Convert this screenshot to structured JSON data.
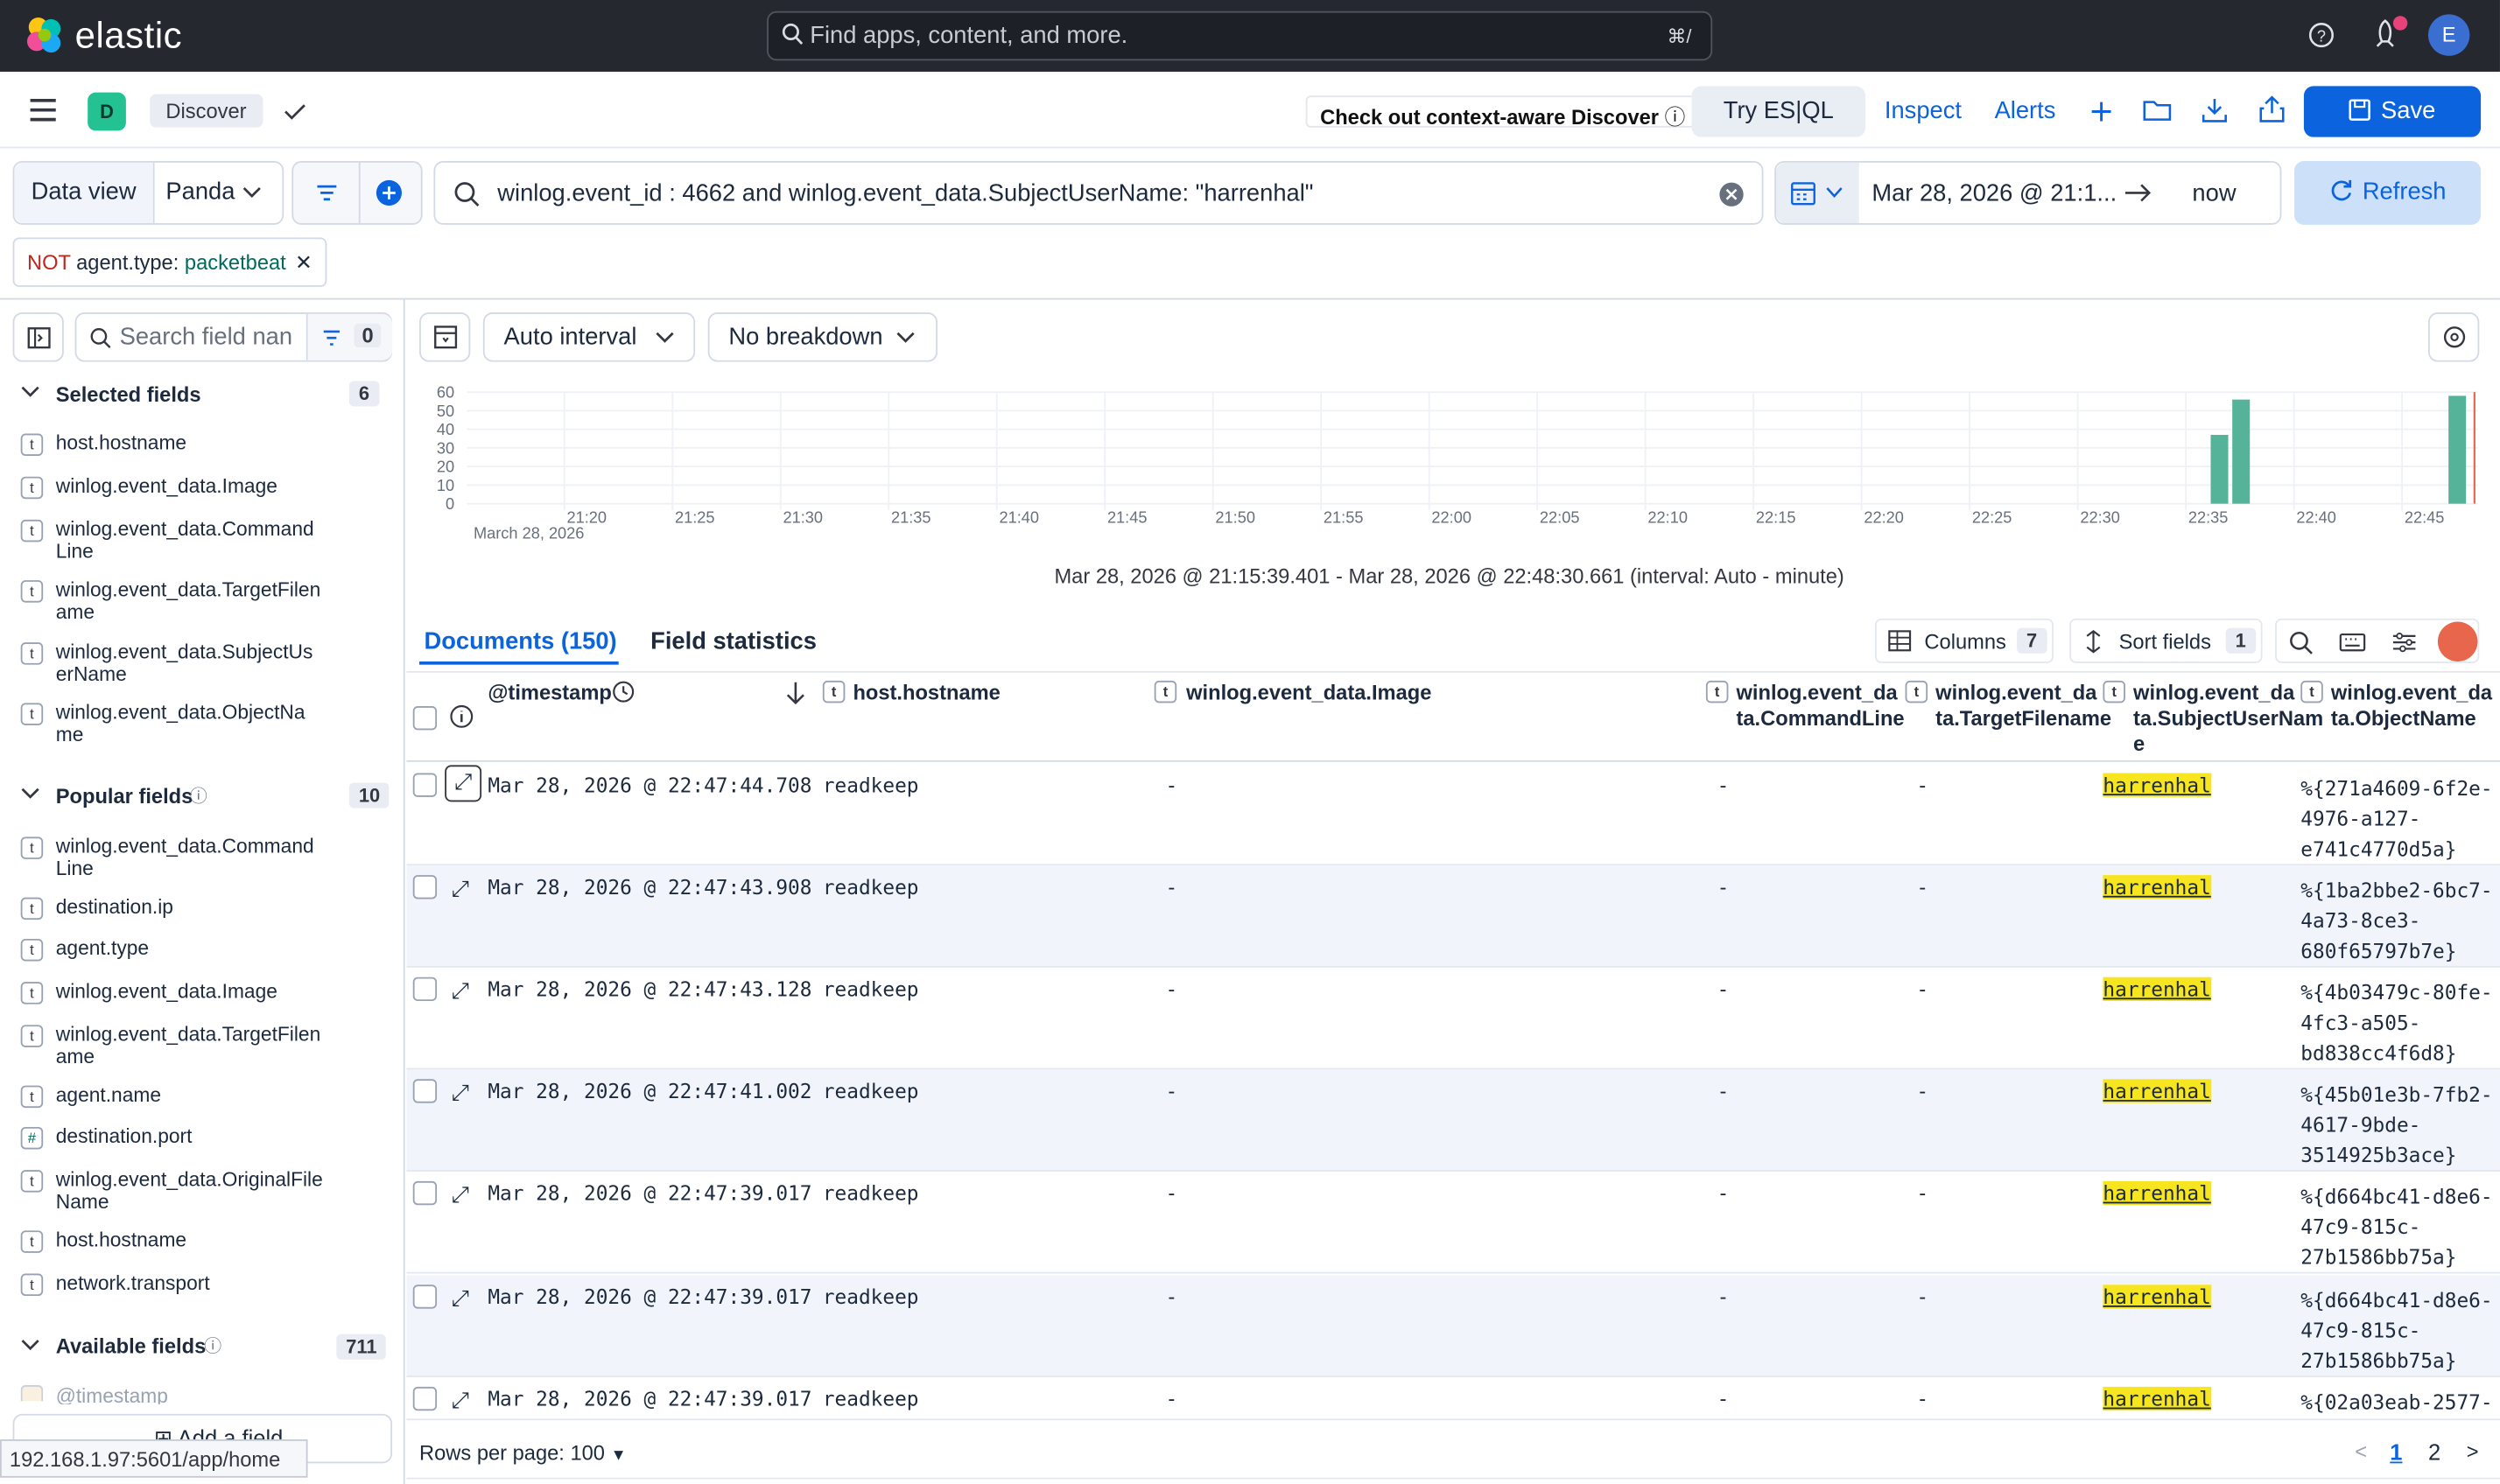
{
  "app": {
    "brand": "elastic",
    "search_placeholder": "Find apps, content, and more.",
    "search_kbd": "⌘/",
    "avatar": "E"
  },
  "toolbar": {
    "badge": "D",
    "breadcrumb": "Discover",
    "context_notice": "Check out context-aware Discover",
    "try_esql": "Try ES|QL",
    "inspect": "Inspect",
    "alerts": "Alerts",
    "save": "Save"
  },
  "querybar": {
    "data_view_label": "Data view",
    "data_view_value": "Panda",
    "query": "winlog.event_id : 4662 and winlog.event_data.SubjectUserName: \"harrenhal\"",
    "date_start": "Mar 28, 2026 @ 21:1...",
    "date_end": "now",
    "refresh": "Refresh"
  },
  "filter": {
    "negation": "NOT",
    "field": "agent.type:",
    "value": "packetbeat"
  },
  "sidebar": {
    "search_placeholder": "Search field nan",
    "filter_count": "0",
    "selected": {
      "title": "Selected fields",
      "count": "6",
      "items": [
        {
          "type": "t",
          "name": "host.hostname"
        },
        {
          "type": "t",
          "name": "winlog.event_data.Image"
        },
        {
          "type": "t",
          "name": "winlog.event_data.Command\nLine"
        },
        {
          "type": "t",
          "name": "winlog.event_data.TargetFilen\name"
        },
        {
          "type": "t",
          "name": "winlog.event_data.SubjectUs\nerName"
        },
        {
          "type": "t",
          "name": "winlog.event_data.ObjectNa\nme"
        }
      ]
    },
    "popular": {
      "title": "Popular fields",
      "count": "10",
      "items": [
        {
          "type": "t",
          "name": "winlog.event_data.Command\nLine"
        },
        {
          "type": "t",
          "name": "destination.ip"
        },
        {
          "type": "t",
          "name": "agent.type"
        },
        {
          "type": "t",
          "name": "winlog.event_data.Image"
        },
        {
          "type": "t",
          "name": "winlog.event_data.TargetFilen\name"
        },
        {
          "type": "t",
          "name": "agent.name"
        },
        {
          "type": "#",
          "name": "destination.port"
        },
        {
          "type": "t",
          "name": "winlog.event_data.OriginalFile\nName"
        },
        {
          "type": "t",
          "name": "host.hostname"
        },
        {
          "type": "t",
          "name": "network.transport"
        }
      ]
    },
    "available": {
      "title": "Available fields",
      "count": "711",
      "first": "@timestamp"
    },
    "add_field": "Add a field"
  },
  "histogram": {
    "interval": "Auto interval",
    "breakdown": "No breakdown",
    "range_text": "Mar 28, 2026 @ 21:15:39.401 - Mar 28, 2026 @ 22:48:30.661 (interval: Auto - minute)"
  },
  "chart_data": {
    "type": "bar",
    "ylim": [
      0,
      60
    ],
    "yticks": [
      "60",
      "50",
      "40",
      "30",
      "20",
      "10",
      "0"
    ],
    "xticks": [
      "21:20",
      "21:25",
      "21:30",
      "21:35",
      "21:40",
      "21:45",
      "21:50",
      "21:55",
      "22:00",
      "22:05",
      "22:10",
      "22:15",
      "22:20",
      "22:25",
      "22:30",
      "22:35",
      "22:40",
      "22:45"
    ],
    "xsub": "March 28, 2026",
    "bars": [
      {
        "x": "22:36",
        "value": 37
      },
      {
        "x": "22:37",
        "value": 56
      },
      {
        "x": "22:47",
        "value": 58
      }
    ],
    "color": "#54b399"
  },
  "tabs": {
    "documents": "Documents (150)",
    "field_stats": "Field statistics",
    "columns": "Columns",
    "columns_count": "7",
    "sort": "Sort fields",
    "sort_count": "1"
  },
  "columns": {
    "timestamp": "@timestamp",
    "hostname": "host.hostname",
    "image": "winlog.event_data.Image",
    "cmd": "winlog.event_da\nta.CommandLine",
    "target": "winlog.event_da\nta.TargetFilename",
    "subject": "winlog.event_da\nta.SubjectUserNam\ne",
    "object": "winlog.event_da\nta.ObjectName"
  },
  "rows": [
    {
      "ts": "Mar 28, 2026 @ 22:47:44.708",
      "host": "readkeep",
      "image": "-",
      "cmd": "-",
      "target": "-",
      "user": "harrenhal",
      "obj": "%{271a4609-6f2e-\n4976-a127-\ne741c4770d5a}"
    },
    {
      "ts": "Mar 28, 2026 @ 22:47:43.908",
      "host": "readkeep",
      "image": "-",
      "cmd": "-",
      "target": "-",
      "user": "harrenhal",
      "obj": "%{1ba2bbe2-6bc7-\n4a73-8ce3-\n680f65797b7e}"
    },
    {
      "ts": "Mar 28, 2026 @ 22:47:43.128",
      "host": "readkeep",
      "image": "-",
      "cmd": "-",
      "target": "-",
      "user": "harrenhal",
      "obj": "%{4b03479c-80fe-\n4fc3-a505-\nbd838cc4f6d8}"
    },
    {
      "ts": "Mar 28, 2026 @ 22:47:41.002",
      "host": "readkeep",
      "image": "-",
      "cmd": "-",
      "target": "-",
      "user": "harrenhal",
      "obj": "%{45b01e3b-7fb2-\n4617-9bde-\n3514925b3ace}"
    },
    {
      "ts": "Mar 28, 2026 @ 22:47:39.017",
      "host": "readkeep",
      "image": "-",
      "cmd": "-",
      "target": "-",
      "user": "harrenhal",
      "obj": "%{d664bc41-d8e6-\n47c9-815c-\n27b1586bb75a}"
    },
    {
      "ts": "Mar 28, 2026 @ 22:47:39.017",
      "host": "readkeep",
      "image": "-",
      "cmd": "-",
      "target": "-",
      "user": "harrenhal",
      "obj": "%{d664bc41-d8e6-\n47c9-815c-\n27b1586bb75a}"
    },
    {
      "ts": "Mar 28, 2026 @ 22:47:39.017",
      "host": "readkeep",
      "image": "-",
      "cmd": "-",
      "target": "-",
      "user": "harrenhal",
      "obj": "%{02a03eab-2577-"
    }
  ],
  "footer": {
    "rows_per_page": "Rows per page: 100",
    "page1": "1",
    "page2": "2"
  },
  "status_url": "192.168.1.97:5601/app/home"
}
